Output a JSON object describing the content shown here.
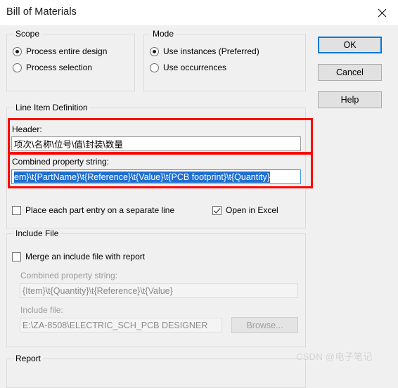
{
  "window": {
    "title": "Bill of Materials",
    "close_icon": "close-icon"
  },
  "scope": {
    "legend": "Scope",
    "options": [
      {
        "label": "Process entire design",
        "selected": true
      },
      {
        "label": "Process selection",
        "selected": false
      }
    ]
  },
  "mode": {
    "legend": "Mode",
    "options": [
      {
        "label": "Use instances (Preferred)",
        "selected": true
      },
      {
        "label": "Use occurrences",
        "selected": false
      }
    ]
  },
  "buttons": {
    "ok": "OK",
    "cancel": "Cancel",
    "help": "Help"
  },
  "line_item_definition": {
    "legend": "Line Item Definition",
    "header_label": "Header:",
    "header_value": "项次\\名称\\位号\\值\\封装\\数量",
    "combined_label": "Combined property string:",
    "combined_value": "em}\\t{PartName}\\t{Reference}\\t{Value}\\t{PCB footprint}\\t{Quantity}",
    "separate_line_checkbox": "Place each part entry on a separate line",
    "separate_line_checked": false,
    "open_in_excel_checkbox": "Open in Excel",
    "open_in_excel_checked": true
  },
  "include_file": {
    "legend": "Include File",
    "merge_checkbox": "Merge an include file with report",
    "merge_checked": false,
    "combined_label": "Combined property string:",
    "combined_value": "{Item}\\t{Quantity}\\t{Reference}\\t{Value}",
    "file_label": "Include file:",
    "file_value": "E:\\ZA-8508\\ELECTRIC_SCH_PCB DESIGNER",
    "browse_button": "Browse..."
  },
  "report": {
    "legend": "Report"
  },
  "watermark": {
    "text": "CSDN @电子笔记"
  },
  "colors": {
    "annotation": "#ff0000",
    "focus": "#0078d7",
    "selection": "#1f6fd0"
  }
}
